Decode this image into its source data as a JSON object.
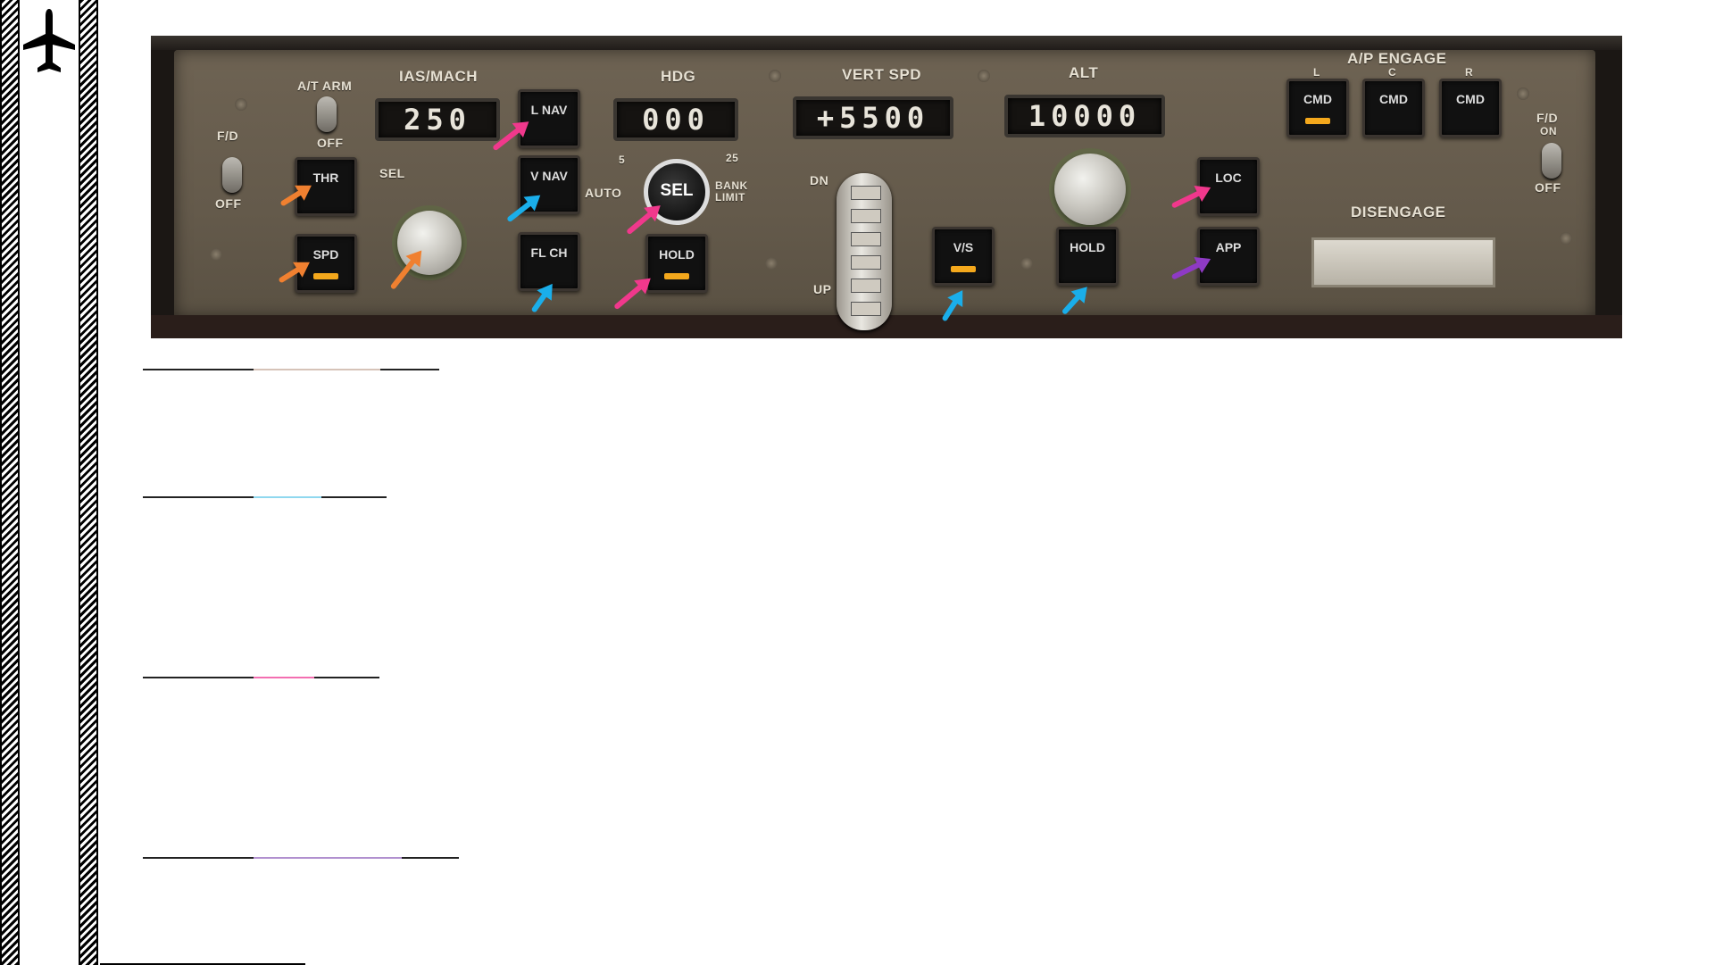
{
  "panel": {
    "ias_mach_label": "IAS/MACH",
    "ias_value": "250",
    "hdg_label": "HDG",
    "hdg_value": "000",
    "vert_spd_label": "VERT SPD",
    "vert_spd_value": "+5500",
    "alt_label": "ALT",
    "alt_value": "10000",
    "at_arm_label": "A/T ARM",
    "at_off_label": "OFF",
    "fd_left_label": "F/D",
    "fd_left_off": "OFF",
    "fd_right_label": "F/D",
    "fd_right_on": "ON",
    "fd_right_off": "OFF",
    "sel_label": "SEL",
    "auto_label": "AUTO",
    "bank_limit_label": "BANK LIMIT",
    "bank_5": "5",
    "bank_25": "25",
    "dn_label": "DN",
    "up_label": "UP",
    "ap_engage_label": "A/P ENGAGE",
    "ap_l": "L",
    "ap_c": "C",
    "ap_r": "R",
    "disengage_label": "DISENGAGE",
    "buttons": {
      "thr": "THR",
      "spd": "SPD",
      "lnav": "L NAV",
      "vnav": "V NAV",
      "flch": "FL CH",
      "hdg_sel": "SEL",
      "hdg_hold": "HOLD",
      "vs": "V/S",
      "alt_hold": "HOLD",
      "loc": "LOC",
      "app": "APP",
      "cmd_l": "CMD",
      "cmd_c": "CMD",
      "cmd_r": "CMD"
    }
  },
  "colors": {
    "autothrottle": "#f08030",
    "vertical": "#1aaeea",
    "lateral": "#f0388c",
    "approach": "#8e3ac4",
    "annunciator": "#f4a81c"
  },
  "icons": {
    "logo": "airplane-icon"
  }
}
